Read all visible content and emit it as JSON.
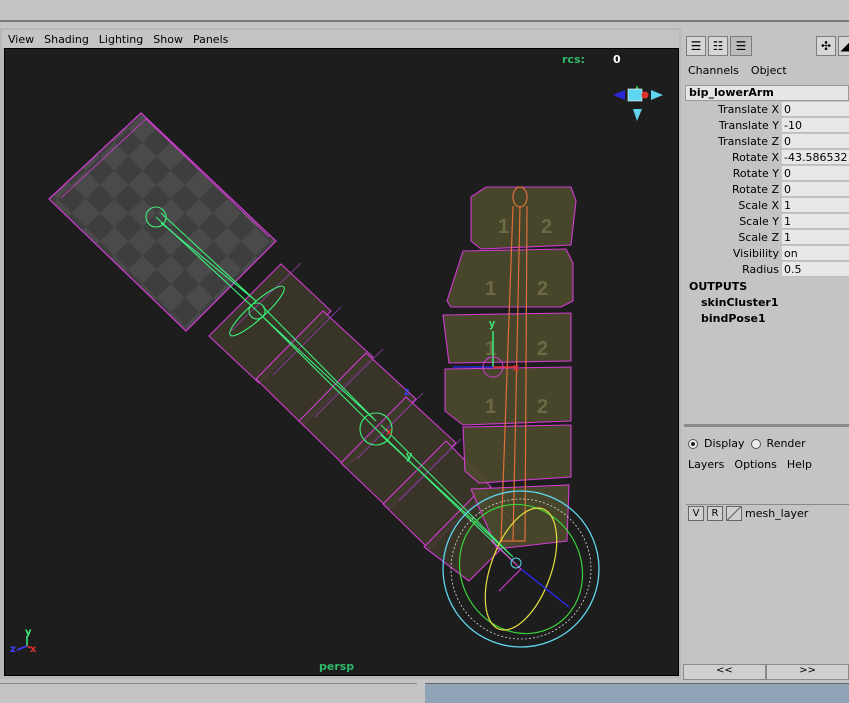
{
  "viewport": {
    "menu": [
      "View",
      "Shading",
      "Lighting",
      "Show",
      "Panels"
    ],
    "hud_label": "rcs:",
    "hud_value": "0",
    "camera_name": "persp",
    "axis": {
      "y": "y",
      "z": "z",
      "x": "x"
    },
    "joint_labels": {
      "y": "y",
      "x": "x",
      "z": "z"
    },
    "uv_numbers": [
      "1",
      "2"
    ]
  },
  "channel_box": {
    "tabs": [
      "Channels",
      "Object"
    ],
    "object_name": "bip_lowerArm",
    "channels": [
      {
        "label": "Translate X",
        "value": "0"
      },
      {
        "label": "Translate Y",
        "value": "-10"
      },
      {
        "label": "Translate Z",
        "value": "0"
      },
      {
        "label": "Rotate X",
        "value": "-43.586532"
      },
      {
        "label": "Rotate Y",
        "value": "0"
      },
      {
        "label": "Rotate Z",
        "value": "0"
      },
      {
        "label": "Scale X",
        "value": "1"
      },
      {
        "label": "Scale Y",
        "value": "1"
      },
      {
        "label": "Scale Z",
        "value": "1"
      },
      {
        "label": "Visibility",
        "value": "on"
      },
      {
        "label": "Radius",
        "value": "0.5"
      }
    ],
    "outputs_title": "OUTPUTS",
    "outputs": [
      "skinCluster1",
      "bindPose1"
    ]
  },
  "layer_editor": {
    "modes": [
      {
        "label": "Display",
        "selected": true
      },
      {
        "label": "Render",
        "selected": false
      }
    ],
    "menu": [
      "Layers",
      "Options",
      "Help"
    ],
    "layer": {
      "v": "V",
      "r": "R",
      "name": "mesh_layer"
    },
    "nav_prev": "<<",
    "nav_next": ">>"
  },
  "colors": {
    "wire_magenta": "#d23cd2",
    "joint_green": "#3cf07a",
    "viewport_bg": "#1d1d1d",
    "hud_green": "#2fb86a"
  }
}
